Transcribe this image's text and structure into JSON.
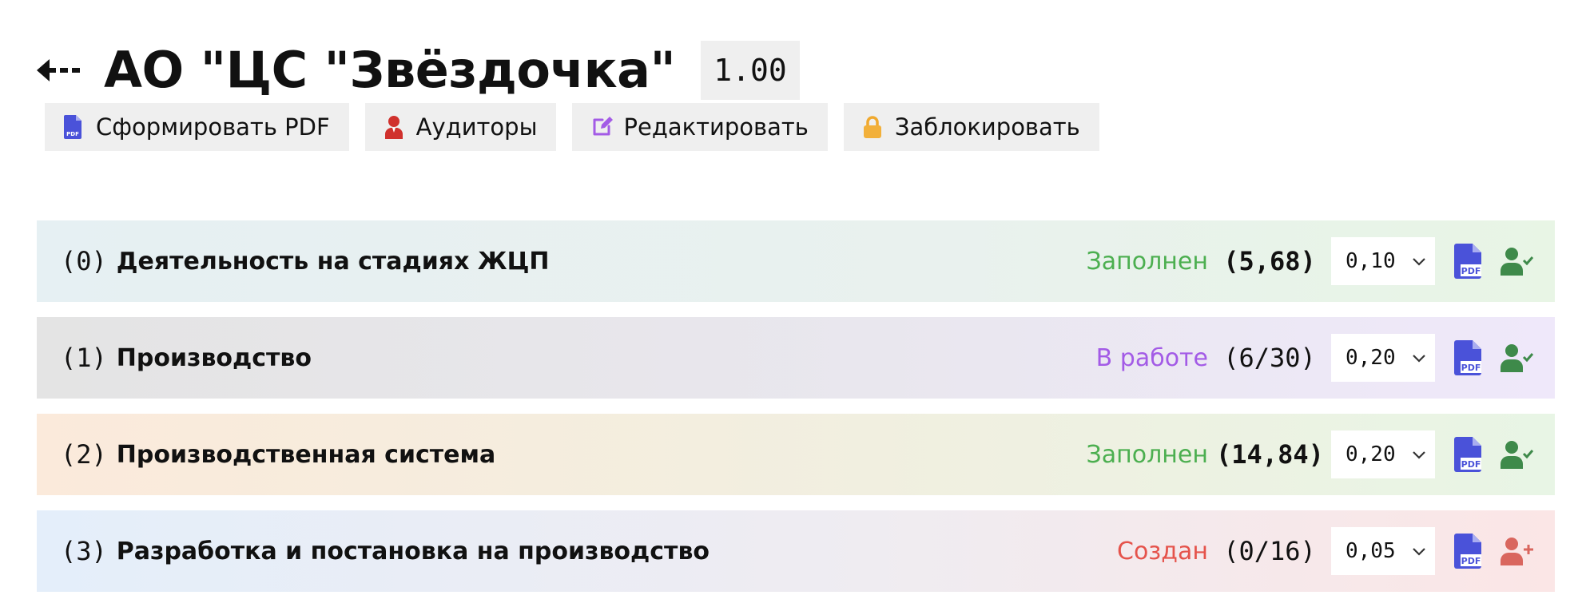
{
  "header": {
    "title": "АО \"ЦС \"Звёздочка\"",
    "version": "1.00"
  },
  "toolbar": {
    "pdf_label": "Сформировать PDF",
    "auditors_label": "Аудиторы",
    "edit_label": "Редактировать",
    "lock_label": "Заблокировать"
  },
  "colors": {
    "status_filled": "#4caf50",
    "status_in_progress": "#a35be6",
    "status_created": "#e5534b",
    "pdf_icon": "#4a52d9",
    "user_check_icon": "#3e8a4a",
    "user_add_icon": "#d9665e"
  },
  "sections": [
    {
      "index": "(0)",
      "title": "Деятельность на стадиях ЖЦП",
      "status": "Заполнен",
      "score": "(5,68)",
      "weight": "0,10",
      "user_icon": "user-check-icon"
    },
    {
      "index": "(1)",
      "title": "Производство",
      "status": "В работе",
      "score": "(6/30)",
      "weight": "0,20",
      "user_icon": "user-check-icon"
    },
    {
      "index": "(2)",
      "title": "Производственная система",
      "status": "Заполнен",
      "score": "(14,84)",
      "weight": "0,20",
      "user_icon": "user-check-icon"
    },
    {
      "index": "(3)",
      "title": "Разработка и постановка на производство",
      "status": "Создан",
      "score": "(0/16)",
      "weight": "0,05",
      "user_icon": "user-plus-icon"
    }
  ]
}
